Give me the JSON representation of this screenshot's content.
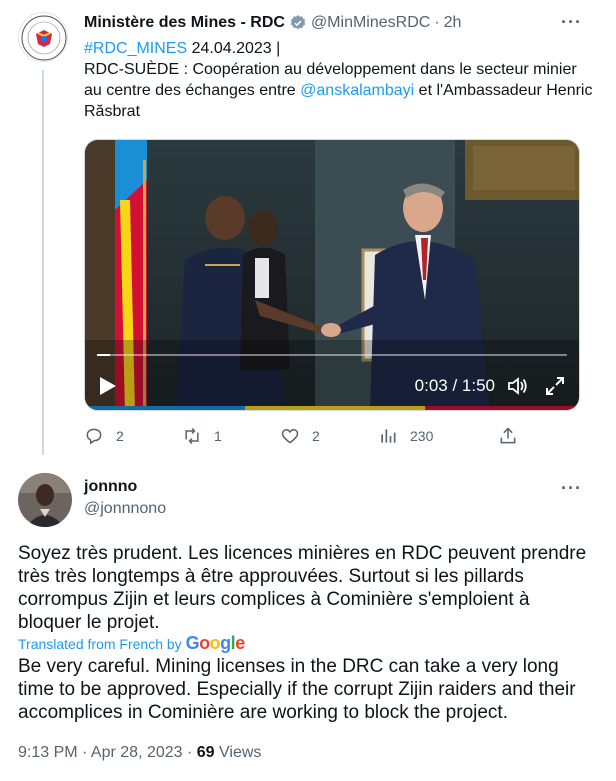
{
  "tweet": {
    "display_name": "Ministère des Mines - RDC",
    "handle": "@MinMinesRDC",
    "separator": "·",
    "time": "2h",
    "hashtag": "#RDC_MINES",
    "date_text": " 24.04.2023 |",
    "text_part1": "RDC-SUÈDE : Coopération au développement dans le secteur minier au centre des échanges entre ",
    "mention": "@anskalambayi",
    "text_part2": " et l'Ambassadeur Henric Răsbrat",
    "video": {
      "elapsed": "0:03",
      "duration": "1:50",
      "time_sep": " / ",
      "progress_fraction": 0.027
    },
    "stats": {
      "replies": "2",
      "retweets": "1",
      "likes": "2",
      "views": "230"
    },
    "icons": [
      "verified-icon",
      "more-icon",
      "play-icon",
      "volume-icon",
      "fullscreen-icon",
      "reply-icon",
      "retweet-icon",
      "like-icon",
      "views-icon",
      "share-icon"
    ]
  },
  "reply": {
    "display_name": "jonnno",
    "handle": "@jonnnono",
    "original_text": "Soyez très prudent. Les licences minières en RDC peuvent prendre très très longtemps à être approuvées. Surtout si les pillards corrompus Zijin et leurs complices à Cominière s'emploient à bloquer le projet.",
    "translated_label": "Translated from French by",
    "translator_brand": "Google",
    "translated_text": "Be very careful. Mining licenses in the DRC can take a very long time to be approved. Especially if the corrupt Zijin raiders and their accomplices in Cominière are working to block the project.",
    "timestamp": "9:13 PM · Apr 28, 2023 · ",
    "views_count": "69",
    "views_label": " Views"
  },
  "colors": {
    "link": "#1d9bf0",
    "muted": "#536471",
    "verified": "#829aab",
    "text": "#0f1419"
  }
}
